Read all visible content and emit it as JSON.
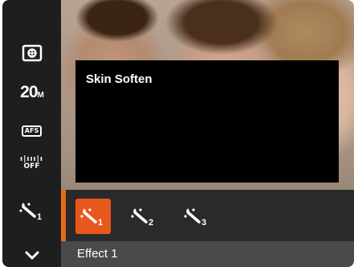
{
  "left_menu": {
    "items": [
      {
        "name": "metering-icon"
      },
      {
        "name": "image-size",
        "value": "20",
        "unit": "M"
      },
      {
        "name": "autofocus-icon",
        "label": "AFS"
      },
      {
        "name": "stabilization-icon",
        "label": "OFF"
      },
      {
        "name": "face-beautifier-icon",
        "level": "1"
      },
      {
        "name": "chevron-down-icon"
      }
    ]
  },
  "popup": {
    "title": "Skin Soften"
  },
  "options": {
    "items": [
      {
        "name": "effect-1-icon",
        "level": "1",
        "selected": true
      },
      {
        "name": "effect-2-icon",
        "level": "2",
        "selected": false
      },
      {
        "name": "effect-3-icon",
        "level": "3",
        "selected": false
      }
    ]
  },
  "status": {
    "label": "Effect 1"
  },
  "colors": {
    "accent": "#e8581c",
    "menu_bg": "#1e1e1e",
    "popup_bg": "#000000"
  }
}
